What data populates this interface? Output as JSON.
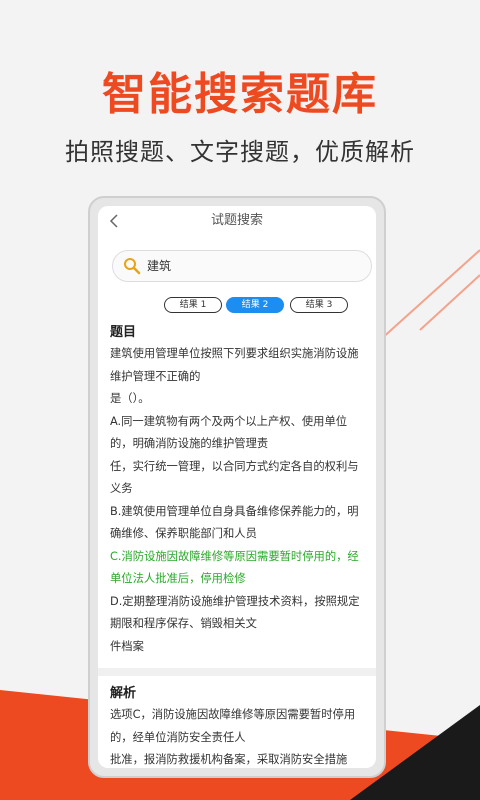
{
  "headline": "智能搜索题库",
  "subline": "拍照搜题、文字搜题，优质解析",
  "app": {
    "title": "试题搜索",
    "search_value": "建筑",
    "tabs": [
      "结果 1",
      "结果 2",
      "结果 3"
    ],
    "active_tab": "结果 2"
  },
  "question": {
    "heading": "题目",
    "lines": [
      "建筑使用管理单位按照下列要求组织实施消防设施",
      "维护管理不正确的",
      "是（）。",
      "A.同一建筑物有两个及两个以上产权、使用单位",
      "的，明确消防设施的维护管理责",
      "任，实行统一管理，以合同方式约定各自的权利与",
      "义务",
      "B.建筑使用管理单位自身具备维修保养能力的，明",
      "确维修、保养职能部门和人员"
    ],
    "highlight_lines": [
      "C.消防设施因故障维修等原因需要暂时停用的，经",
      "单位法人批准后，停用检修"
    ],
    "tail_lines": [
      "D.定期整理消防设施维护管理技术资料，按照规定",
      "期限和程序保存、销毁相关文",
      "件档案"
    ]
  },
  "analysis": {
    "heading": "解析",
    "lines": [
      "选项C，消防设施因故障维修等原因需要暂时停用",
      "的，经单位消防安全责任人",
      "批准，报消防救援机构备案，采取消防安全措施"
    ]
  },
  "colors": {
    "accent": "#ee4a22",
    "tab_active": "#1d8ef0",
    "highlight_text": "#2aa82a"
  }
}
